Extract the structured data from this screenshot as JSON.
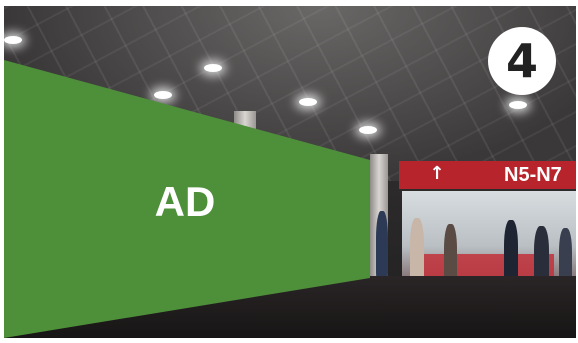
{
  "ad_label": "AD",
  "badge_number": "4",
  "sign": {
    "arrow": "↑",
    "text": "N5-N7"
  },
  "colors": {
    "ad_panel": "#4e8f3a",
    "sign_red": "#b8242c"
  }
}
